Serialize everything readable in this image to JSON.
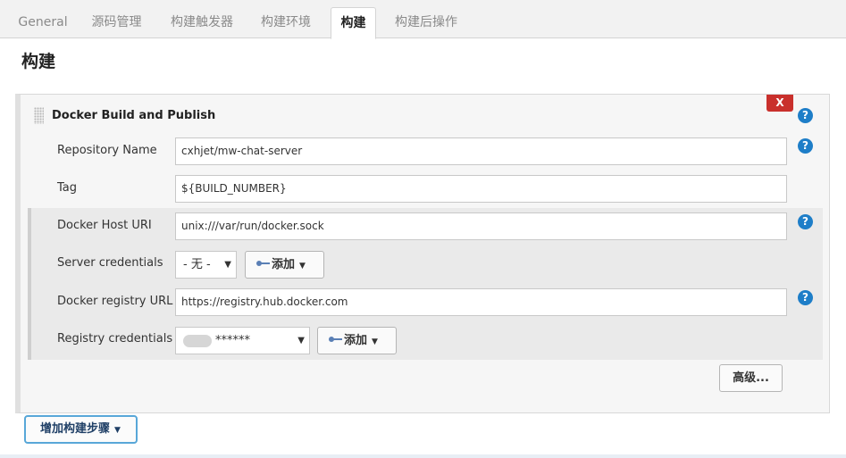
{
  "tabs": [
    {
      "label": "General"
    },
    {
      "label": "源码管理"
    },
    {
      "label": "构建触发器"
    },
    {
      "label": "构建环境"
    },
    {
      "label": "构建"
    },
    {
      "label": "构建后操作"
    }
  ],
  "active_tab": "构建",
  "section_title": "构建",
  "step": {
    "title": "Docker Build and Publish",
    "delete_label": "X",
    "help_label": "?"
  },
  "fields": {
    "repository_name": {
      "label": "Repository Name",
      "value": "cxhjet/mw-chat-server"
    },
    "tag": {
      "label": "Tag",
      "value": "${BUILD_NUMBER}"
    },
    "docker_host_uri": {
      "label": "Docker Host URI",
      "value": "unix:///var/run/docker.sock"
    },
    "server_credentials": {
      "label": "Server credentials",
      "selected": "- 无 -",
      "add_label": "添加"
    },
    "docker_registry_url": {
      "label": "Docker registry URL",
      "value": "https://registry.hub.docker.com"
    },
    "registry_credentials": {
      "label": "Registry credentials",
      "selected": "******",
      "add_label": "添加"
    }
  },
  "advanced_label": "高级...",
  "add_step_label": "增加构建步骤",
  "colors": {
    "delete": "#c9302c",
    "help": "#1e7ec8",
    "add_step_border": "#58a7d8",
    "key": "#5a7fb5"
  },
  "icons": [
    "drag-handle-icon",
    "help-icon",
    "key-icon",
    "caret-down-icon"
  ]
}
